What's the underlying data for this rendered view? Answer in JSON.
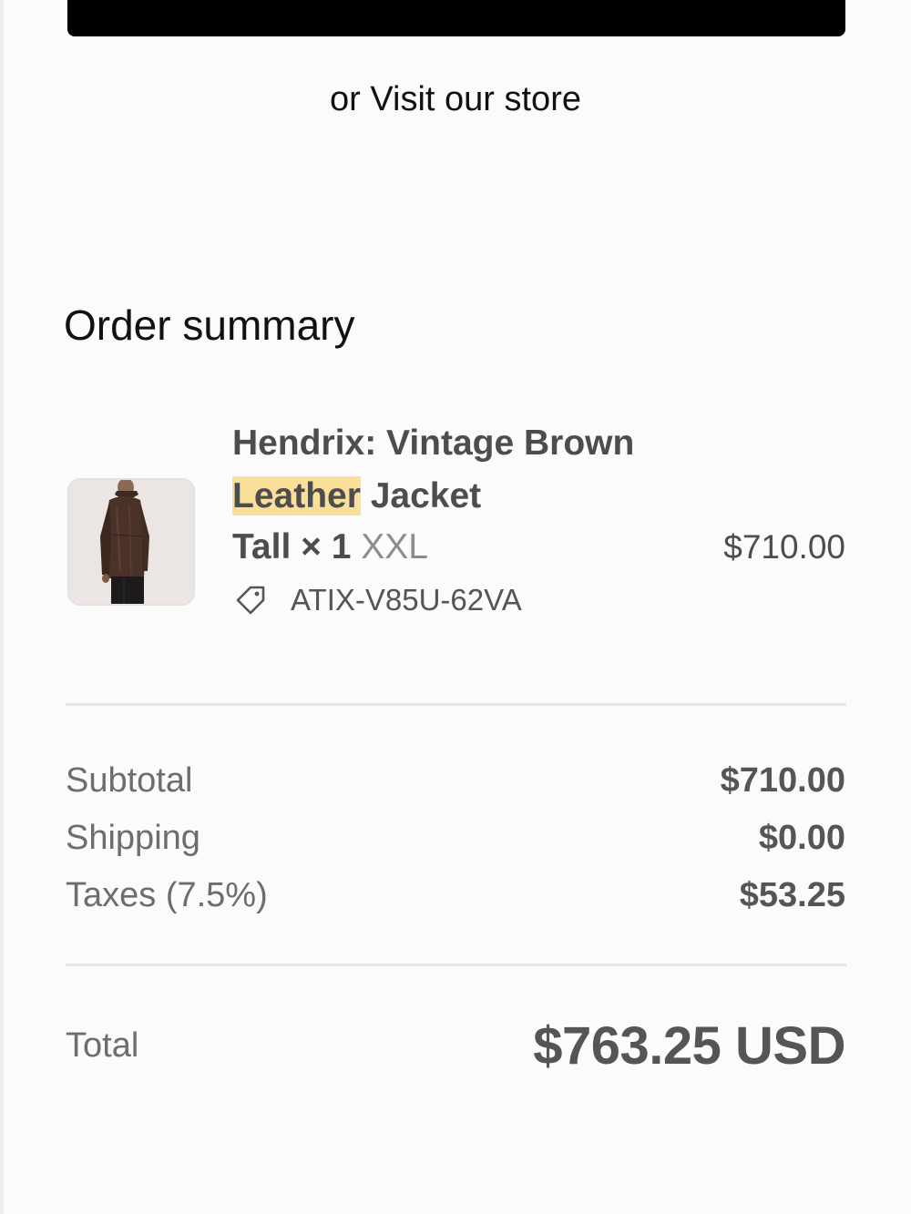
{
  "top_button": {
    "label": ""
  },
  "visit_store": "or Visit our store",
  "order_summary": {
    "title": "Order summary",
    "item": {
      "title_part1": "Hendrix: Vintage Brown ",
      "title_highlight": "Leather",
      "title_part2": " Jacket Tall",
      "quantity": "× 1",
      "size": "XXL",
      "price": "$710.00",
      "discount_code": "ATIX-V85U-62VA",
      "image_icon": "jacket-product-image"
    },
    "lines": [
      {
        "label": "Subtotal",
        "value": "$710.00"
      },
      {
        "label": "Shipping",
        "value": "$0.00"
      },
      {
        "label": "Taxes (7.5%)",
        "value": "$53.25"
      }
    ],
    "total": {
      "label": "Total",
      "value": "$763.25 USD"
    }
  },
  "colors": {
    "highlight": "#f9df9a",
    "button": "#000000",
    "text_muted": "#6d6d6d",
    "text_strong": "#4d4d4d"
  }
}
